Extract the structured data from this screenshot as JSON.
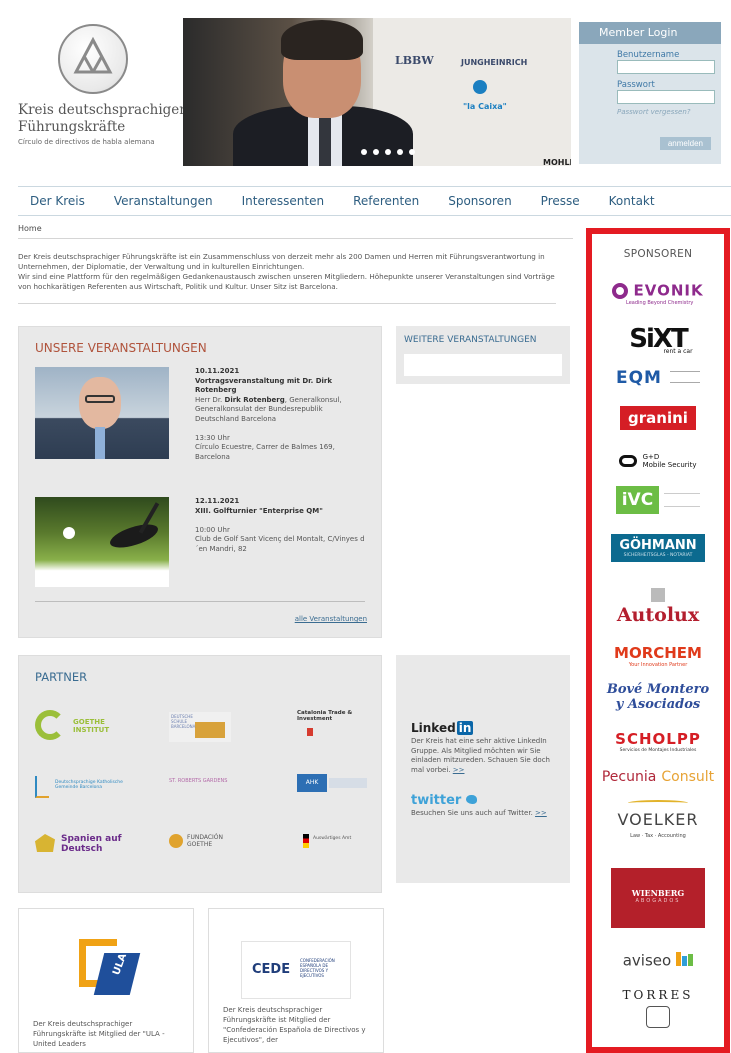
{
  "logo": {
    "title_line1": "Kreis deutschsprachiger",
    "title_line2": "Führungskräfte",
    "subtitle": "Círculo de directivos de habla alemana"
  },
  "hero": {
    "wall_logos": [
      "LBBW",
      "JUNGHEINRICH",
      "\"la Caixa\"",
      "MOHLE"
    ]
  },
  "login": {
    "heading": "Member Login",
    "username_label": "Benutzername",
    "password_label": "Passwort",
    "forgot": "Passwort vergessen?",
    "submit": "anmelden"
  },
  "nav": [
    "Der Kreis",
    "Veranstaltungen",
    "Interessenten",
    "Referenten",
    "Sponsoren",
    "Presse",
    "Kontakt"
  ],
  "breadcrumb": "Home",
  "intro": {
    "p1": "Der Kreis deutschsprachiger Führungskräfte ist ein Zusammenschluss von derzeit mehr als 200 Damen und Herren mit Führungsverantwortung in Unternehmen, der Diplomatie, der Verwaltung und in kulturellen Einrichtungen.",
    "p2": "Wir sind eine Plattform für den regelmäßigen Gedankenaustausch zwischen unseren Mitgliedern. Höhepunkte unserer Veranstaltungen sind Vorträge von hochkarätigen Referenten aus Wirtschaft, Politik und Kultur. Unser Sitz ist Barcelona."
  },
  "events": {
    "heading": "UNSERE VERANSTALTUNGEN",
    "items": [
      {
        "date": "10.11.2021",
        "title": "Vortragsveranstaltung mit Dr. Dirk Rotenberg",
        "desc_prefix": "Herr Dr. ",
        "desc_name": "Dirk Rotenberg",
        "desc_suffix": ", Generalkonsul, Generalkonsulat der Bundesrepublik Deutschland Barcelona",
        "time": "13:30 Uhr",
        "place": "Círculo Ecuestre, Carrer de Balmes 169, Barcelona"
      },
      {
        "date": "12.11.2021",
        "title": "XIII. Golfturnier \"Enterprise QM\"",
        "time": "10:00 Uhr",
        "place": "Club de Golf Sant Vicenç del Montalt, C/Vinyes d´en Mandri, 82"
      }
    ],
    "all_link": "alle Veranstaltungen"
  },
  "more_events": {
    "heading": "WEITERE VERANSTALTUNGEN"
  },
  "partner": {
    "heading": "PARTNER",
    "logos": [
      "GOETHE INSTITUT",
      "DEUTSCHE SCHULE BARCELONA",
      "Catalonia Trade & Investment",
      "Deutschsprachige Katholische Gemeinde Barcelona",
      "ST. ROBERTS GARDENS",
      "AHK",
      "Spanien auf Deutsch",
      "FUNDACIÓN GOETHE",
      "Auswärtiges Amt"
    ]
  },
  "social": {
    "linkedin_word": "Linked",
    "linkedin_in": "in",
    "linkedin_text": "Der Kreis hat eine sehr aktive LinkedIn Gruppe. Als Mitglied möchten wir Sie einladen mitzureden. Schauen Sie doch mal vorbei.",
    "twitter_logo": "twitter",
    "twitter_text": "Besuchen Sie uns auch auf Twitter.",
    "more": ">>"
  },
  "cards": {
    "ula_text": "Der Kreis deutschsprachiger Führungskräfte ist Mitglied der \"ULA - United Leaders",
    "ula_logo": "ULA",
    "cede_logo": "CEDE",
    "cede_sub": "CONFEDERACIÓN ESPAÑOLA DE DIRECTIVOS Y EJECUTIVOS",
    "cede_text": "Der Kreis deutschsprachiger Führungskräfte ist Mitglied der \"Confederación Española de Directivos y Ejecutivos\", der"
  },
  "sponsors": {
    "heading": "SPONSOREN",
    "list": {
      "evonik": "EVONIK",
      "evonik_sub": "Leading Beyond Chemistry",
      "sixt": "SiXT",
      "sixt_sub": "rent a car",
      "eqm": "EQM",
      "granini": "granini",
      "gd": "G+D",
      "gd_sub": "Mobile Security",
      "ivc": "iVC",
      "gohmann": "GÖHMANN",
      "gohmann_sub": "SICHERHEITSGLAS - NOTARIAT",
      "autolux": "Autolux",
      "morchem": "MORCHEM",
      "morchem_sub": "Your Innovation Partner",
      "bove1": "Bové Montero",
      "bove2": "y Asociados",
      "scholpp": "SCHOLPP",
      "scholpp_sub": "Servicios de Montajes Industriales",
      "pecunia1": "Pecunia",
      "pecunia2": "Consult",
      "voelker": "VOELKER",
      "voelker_sub": "Law · Tax · Accounting",
      "wienberg": "WIENBERG",
      "wienberg_sub": "ABOGADOS",
      "aviseo": "aviseo",
      "torres": "TORRES"
    }
  },
  "colors": {
    "accent_red": "#e41b22",
    "nav_blue": "#2d5d80",
    "event_heading": "#b0533c"
  }
}
